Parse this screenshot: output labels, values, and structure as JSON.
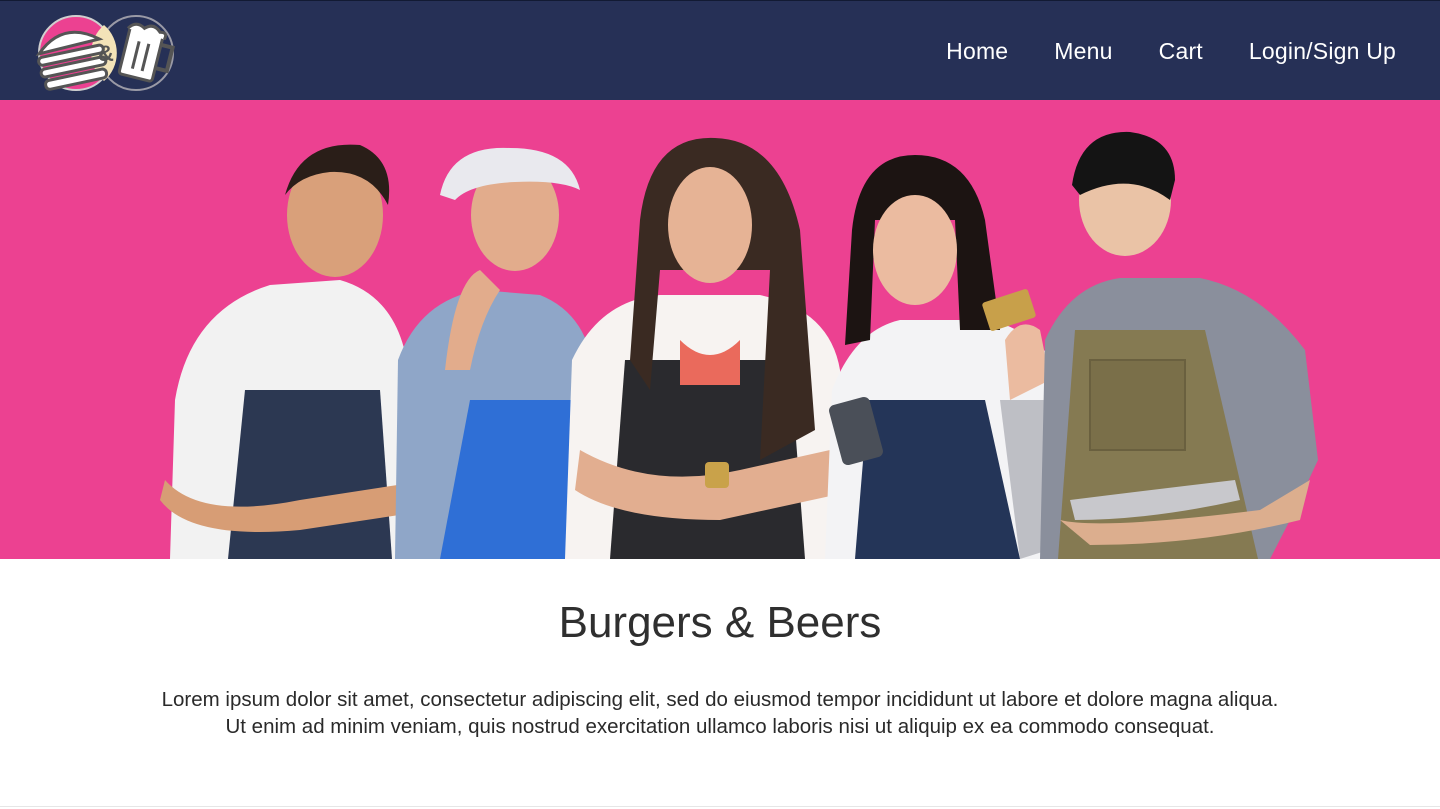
{
  "brand": {
    "logo_icon": "burger-and-beer-icon",
    "logo_ampersand": "&"
  },
  "nav": {
    "items": [
      {
        "label": "Home"
      },
      {
        "label": "Menu"
      },
      {
        "label": "Cart"
      },
      {
        "label": "Login/Sign Up"
      }
    ]
  },
  "hero": {
    "image": "staff-team-photo",
    "background_color": "#ec4191"
  },
  "main": {
    "title": "Burgers & Beers",
    "description_lines": [
      "Lorem ipsum dolor sit amet, consectetur adipiscing elit, sed do eiusmod tempor incididunt ut labore et dolore magna aliqua.",
      "Ut enim ad minim veniam, quis nostrud exercitation ullamco laboris nisi ut aliquip ex ea commodo consequat."
    ]
  },
  "colors": {
    "navbar": "#263056",
    "accent_pink": "#ec4191",
    "text": "#2f2f2f"
  }
}
